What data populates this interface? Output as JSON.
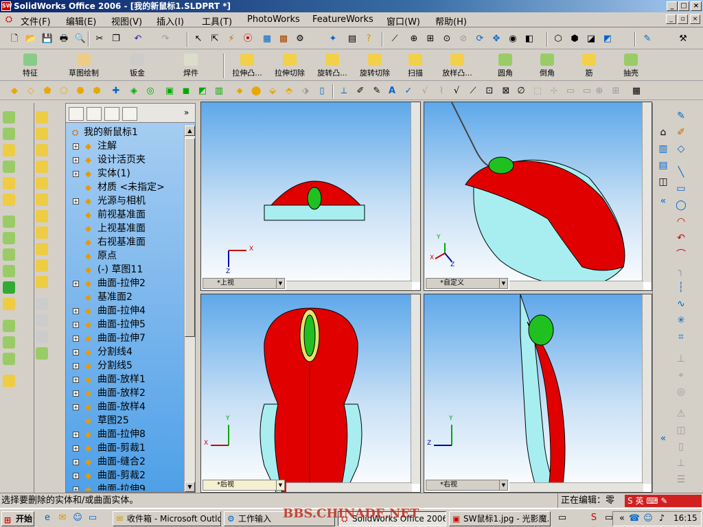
{
  "window": {
    "title": "SolidWorks Office 2006 - [我的新鼠标1.SLDPRT *]",
    "logo": "SW"
  },
  "menu": [
    "文件(F)",
    "编辑(E)",
    "视图(V)",
    "插入(I)",
    "工具(T)",
    "PhotoWorks",
    "FeatureWorks",
    "窗口(W)",
    "帮助(H)"
  ],
  "commandmanager": [
    "特征",
    "草图绘制",
    "钣金",
    "焊件",
    "拉伸凸...",
    "拉伸切除",
    "旋转凸...",
    "旋转切除",
    "扫描",
    "放样凸...",
    "圆角",
    "倒角",
    "筋",
    "抽壳"
  ],
  "tree": {
    "root": "我的新鼠标1",
    "items": [
      {
        "label": "注解",
        "exp": true
      },
      {
        "label": "设计活页夹",
        "exp": true
      },
      {
        "label": "实体(1)",
        "exp": true
      },
      {
        "label": "材质 <未指定>",
        "exp": false
      },
      {
        "label": "光源与相机",
        "exp": true
      },
      {
        "label": "前视基准面",
        "exp": false
      },
      {
        "label": "上视基准面",
        "exp": false
      },
      {
        "label": "右视基准面",
        "exp": false
      },
      {
        "label": "原点",
        "exp": false
      },
      {
        "label": "(-) 草图11",
        "exp": false
      },
      {
        "label": "曲面-拉伸2",
        "exp": true
      },
      {
        "label": "基准面2",
        "exp": false
      },
      {
        "label": "曲面-拉伸4",
        "exp": true
      },
      {
        "label": "曲面-拉伸5",
        "exp": true
      },
      {
        "label": "曲面-拉伸7",
        "exp": true
      },
      {
        "label": "分割线4",
        "exp": true
      },
      {
        "label": "分割线5",
        "exp": true
      },
      {
        "label": "曲面-放样1",
        "exp": true
      },
      {
        "label": "曲面-放样2",
        "exp": true
      },
      {
        "label": "曲面-放样4",
        "exp": true
      },
      {
        "label": "草图25",
        "exp": false
      },
      {
        "label": "曲面-拉伸8",
        "exp": true
      },
      {
        "label": "曲面-剪裁1",
        "exp": true
      },
      {
        "label": "曲面-缝合2",
        "exp": true
      },
      {
        "label": "曲面-剪裁2",
        "exp": true
      },
      {
        "label": "曲面-拉伸9",
        "exp": true
      }
    ]
  },
  "views": {
    "top": "*上视",
    "custom": "*自定义",
    "back": "*后视",
    "right": "*右视"
  },
  "axes": {
    "x": "X",
    "y": "Y",
    "z": "Z"
  },
  "statusbar": {
    "hint": "选择要删除的实体和/或曲面实体。",
    "editing": "正在编辑：零件",
    "ime": "英"
  },
  "taskbar": {
    "start": "开始",
    "tasks": [
      "收件箱 - Microsoft Outlook",
      "工作输入",
      "SolidWorks Office 2006 -...",
      "SW鼠标1.jpg - 光影魔..."
    ],
    "watermark": "BBS.CHINADE.NET",
    "clock": "16:15"
  },
  "colors": {
    "accent": "#0a246a",
    "body": "#e00000",
    "side": "#a8eef0",
    "wheel": "#20c020"
  }
}
